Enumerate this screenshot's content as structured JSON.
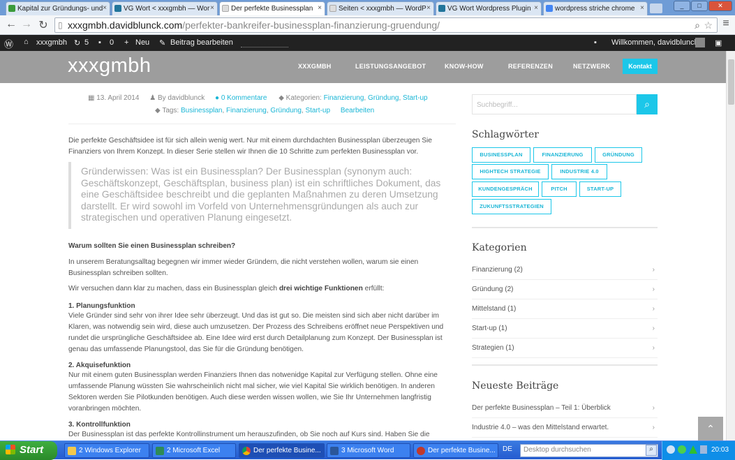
{
  "browser": {
    "tabs": [
      {
        "label": "Kapital zur Gründungs- und"
      },
      {
        "label": "VG Wort < xxxgmbh — Wor"
      },
      {
        "label": "Der perfekte Businessplan"
      },
      {
        "label": "Seiten < xxxgmbh — WordP"
      },
      {
        "label": "VG Wort Wordpress Plugin"
      },
      {
        "label": "wordpress striche chrome"
      }
    ],
    "url_host": "xxxgmbh.davidblunck.com",
    "url_path": "/perfekter-bankreifer-businessplan-finanzierung-gruendung/"
  },
  "adminbar": {
    "site": "xxxgmbh",
    "updates": "5",
    "comments": "0",
    "new": "Neu",
    "edit": "Beitrag bearbeiten",
    "welcome": "Willkommen, davidblunck"
  },
  "site": {
    "logo": "xxxgmbh",
    "menu": [
      "XXXGMBH",
      "LEISTUNGSANGEBOT",
      "KNOW-HOW",
      "REFERENZEN",
      "NETZWERK"
    ],
    "contact": "Kontakt"
  },
  "post": {
    "date": "13. April 2014",
    "by": "By davidblunck",
    "comments": "0 Kommentare",
    "categories_label": "Kategorien:",
    "categories": [
      "Finanzierung",
      "Gründung",
      "Start-up"
    ],
    "tags_label": "Tags:",
    "tags": [
      "Businessplan",
      "Finanzierung",
      "Gründung",
      "Start-up"
    ],
    "edit": "Bearbeiten",
    "intro": "Die perfekte Geschäftsidee ist für sich allein wenig wert. Nur mit einem durchdachten Businessplan überzeugen Sie Finanziers von Ihrem Konzept. In dieser Serie stellen wir Ihnen die 10 Schritte zum perfekten Businessplan vor.",
    "quote": "Gründerwissen: Was ist ein Businessplan? Der Businessplan (synonym auch: Geschäftskonzept, Geschäftsplan, business plan) ist ein schriftliches Dokument, das eine Geschäftsidee beschreibt und die geplanten Maßnahmen zu deren Umsetzung darstellt. Er wird sowohl im Vorfeld von Unternehmensgründungen als auch zur strategischen und operativen Planung eingesetzt.",
    "h_why": "Warum sollten Sie einen Businessplan schreiben?",
    "p_why": "In unserem Beratungsalltag begegnen wir immer wieder Gründern, die nicht verstehen wollen, warum sie einen Businessplan schreiben sollten.",
    "p_try_a": "Wir versuchen dann klar zu machen, dass ein Businessplan gleich ",
    "p_try_b": "drei wichtige Funktionen",
    "p_try_c": " erfüllt:",
    "h1": "1. Planungsfunktion",
    "p1": "Viele Gründer sind sehr von ihrer Idee sehr überzeugt. Und das ist gut so. Die meisten sind sich aber nicht darüber im Klaren, was notwendig sein wird, diese auch umzusetzen. Der Prozess des Schreibens eröffnet neue Perspektiven und rundet die ursprüngliche Geschäftsidee ab. Eine Idee wird erst durch Detailplanung zum Konzept. Der Businessplan ist genau das umfassende Planungstool, das Sie für die Gründung benötigen.",
    "h2": "2. Akquisefunktion",
    "p2": "Nur mit einem guten Businessplan werden Finanziers Ihnen das notwenidge Kapital zur Verfügung stellen. Ohne eine umfassende Planung wüssten Sie wahrscheinlich nicht mal sicher, wie viel Kapital Sie wirklich benötigen. In anderen Sektoren werden Sie Pilotkunden benötigen. Auch diese werden wissen wollen, wie Sie Ihr Unternehmen langfristig voranbringen möchten.",
    "h3": "3. Kontrollfunktion",
    "p3": "Der Businessplan ist das perfekte Kontrollinstrument um herauszufinden, ob Sie noch auf Kurs sind. Haben Sie die"
  },
  "sidebar": {
    "search_placeholder": "Suchbegriff...",
    "tags_title": "Schlagwörter",
    "tags": [
      "BUSINESSPLAN",
      "FINANZIERUNG",
      "GRÜNDUNG",
      "HIGHTECH STRATEGIE",
      "INDUSTRIE 4.0",
      "KUNDENGESPRÄCH",
      "PITCH",
      "START-UP",
      "ZUKUNFTSSTRATEGIEN"
    ],
    "categories_title": "Kategorien",
    "categories": [
      "Finanzierung (2)",
      "Gründung (2)",
      "Mittelstand (1)",
      "Start-up (1)",
      "Strategien (1)"
    ],
    "recent_title": "Neueste Beiträge",
    "recent": [
      "Der perfekte Businessplan – Teil 1: Überblick",
      "Industrie 4.0 – was den Mittelstand erwartet."
    ]
  },
  "taskbar": {
    "start": "Start",
    "tasks": [
      "2 Windows Explorer",
      "2 Microsoft Excel",
      "Der perfekte Busine...",
      "3 Microsoft Word",
      "Der perfekte Busine..."
    ],
    "lang": "DE",
    "search_placeholder": "Desktop durchsuchen",
    "time": "20:03"
  },
  "colors": {
    "accent": "#1cc7e9",
    "header": "#9d9d9d",
    "adminbar": "#222222"
  }
}
